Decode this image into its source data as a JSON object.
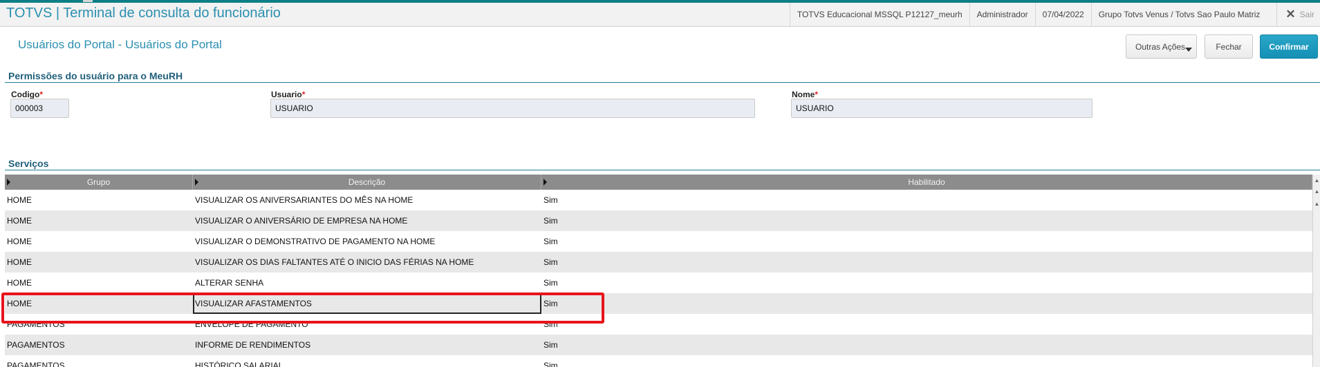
{
  "app": {
    "title": "TOTVS | Terminal de consulta do funcionário",
    "env": "TOTVS Educacional MSSQL P12127_meurh",
    "user": "Administrador",
    "date": "07/04/2022",
    "company": "Grupo Totvs Venus / Totvs Sao Paulo Matriz",
    "exit_label": "Sair",
    "exit_icon": "close-icon"
  },
  "page": {
    "title": "Usuários do Portal - Usuários do Portal",
    "actions": {
      "outras": "Outras Ações",
      "fechar": "Fechar",
      "confirmar": "Confirmar"
    }
  },
  "permissions": {
    "section_title": "Permissões do usuário para o MeuRH",
    "codigo": {
      "label": "Codigo",
      "required": "*",
      "value": "000003"
    },
    "usuario": {
      "label": "Usuario",
      "required": "*",
      "value": "USUARIO"
    },
    "nome": {
      "label": "Nome",
      "required": "*",
      "value": "USUARIO"
    }
  },
  "services": {
    "section_title": "Serviços",
    "columns": [
      "Grupo",
      "Descrição",
      "Habilitado"
    ],
    "rows": [
      [
        "HOME",
        "VISUALIZAR OS ANIVERSARIANTES DO MÊS NA HOME",
        "Sim"
      ],
      [
        "HOME",
        "VISUALIZAR O ANIVERSÁRIO DE EMPRESA NA HOME",
        "Sim"
      ],
      [
        "HOME",
        "VISUALIZAR O DEMONSTRATIVO DE PAGAMENTO NA HOME",
        "Sim"
      ],
      [
        "HOME",
        "VISUALIZAR OS DIAS FALTANTES ATÉ O INICIO DAS FÉRIAS NA HOME",
        "Sim"
      ],
      [
        "HOME",
        "ALTERAR SENHA",
        "Sim"
      ],
      [
        "HOME",
        "VISUALIZAR AFASTAMENTOS",
        "Sim"
      ],
      [
        "PAGAMENTOS",
        "ENVELOPE DE PAGAMENTO",
        "Sim"
      ],
      [
        "PAGAMENTOS",
        "INFORME DE RENDIMENTOS",
        "Sim"
      ],
      [
        "PAGAMENTOS",
        "HISTÓRICO SALARIAL",
        "Sim"
      ]
    ],
    "selected_row": 5
  },
  "colors": {
    "accent": "#2a8fb0",
    "highlight": "#e8141b",
    "confirm": "#1490b5"
  }
}
